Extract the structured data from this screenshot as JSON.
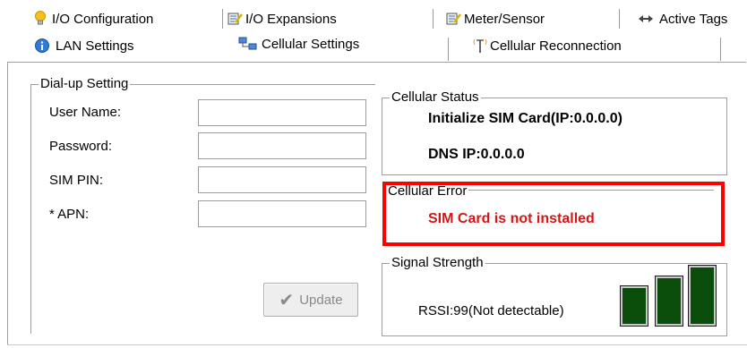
{
  "tabs_row1": [
    {
      "label": "I/O Configuration",
      "icon": "bulb-icon"
    },
    {
      "label": "I/O Expansions",
      "icon": "io-expansion-icon"
    },
    {
      "label": "Meter/Sensor",
      "icon": "meter-icon"
    },
    {
      "label": "Active Tags",
      "icon": "active-tags-icon"
    }
  ],
  "tabs_row2": [
    {
      "label": "LAN Settings",
      "icon": "info-icon"
    },
    {
      "label": "Cellular Settings",
      "icon": "network-icon",
      "selected": true
    },
    {
      "label": "Cellular Reconnection",
      "icon": "antenna-icon"
    }
  ],
  "dialup": {
    "title": "Dial-up Setting",
    "fields": [
      {
        "label": "User Name:",
        "value": ""
      },
      {
        "label": "Password:",
        "value": ""
      },
      {
        "label": "SIM PIN:",
        "value": ""
      },
      {
        "label": "* APN:",
        "value": ""
      }
    ],
    "update_label": "Update"
  },
  "cellular_status": {
    "title": "Cellular Status",
    "line1": "Initialize SIM Card(IP:0.0.0.0)",
    "line2": "DNS IP:0.0.0.0"
  },
  "cellular_error": {
    "title": "Cellular Error",
    "message": "SIM Card is not installed",
    "color": "#d01818"
  },
  "signal": {
    "title": "Signal Strength",
    "rssi_text": "RSSI:99(Not detectable)",
    "bar_color": "#0b4d0b"
  },
  "colors": {
    "highlight": "#ff0000"
  }
}
